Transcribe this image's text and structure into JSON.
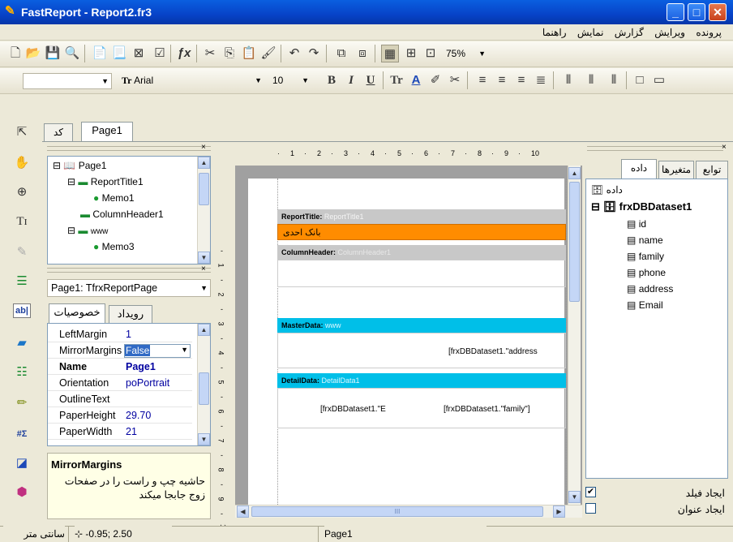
{
  "window": {
    "title": "FastReport - Report2.fr3",
    "minimize": "_",
    "maximize": "□",
    "close": "✕"
  },
  "menu": [
    "پرونده",
    "ویرایش",
    "گزارش",
    "نمایش",
    "راهنما"
  ],
  "toolbar1": {
    "zoom": "75%"
  },
  "toolbar2": {
    "font_name": "Arial",
    "font_size": "10",
    "bold": "B",
    "italic": "I",
    "underline": "U"
  },
  "design_tabs": {
    "code": "کد",
    "page": "Page1"
  },
  "report_tree": [
    {
      "label": "Page1",
      "level": 0,
      "type": "page"
    },
    {
      "label": "ReportTitle1",
      "level": 1,
      "type": "band"
    },
    {
      "label": "Memo1",
      "level": 2,
      "type": "memo"
    },
    {
      "label": "ColumnHeader1",
      "level": 1,
      "type": "band"
    },
    {
      "label": "www",
      "level": 1,
      "type": "band"
    },
    {
      "label": "Memo3",
      "level": 2,
      "type": "memo"
    }
  ],
  "object_selector": "Page1: TfrxReportPage",
  "inspector_tabs": {
    "properties": "خصوصیات",
    "events": "رویداد"
  },
  "properties": [
    {
      "name": "LeftMargin",
      "value": "1",
      "bold": false
    },
    {
      "name": "MirrorMargins",
      "value": "False",
      "bold": false,
      "selected": true
    },
    {
      "name": "Name",
      "value": "Page1",
      "bold": true
    },
    {
      "name": "Orientation",
      "value": "poPortrait",
      "bold": false
    },
    {
      "name": "OutlineText",
      "value": "",
      "bold": false
    },
    {
      "name": "PaperHeight",
      "value": "29.70",
      "bold": false
    },
    {
      "name": "PaperWidth",
      "value": "21",
      "bold": false
    }
  ],
  "help": {
    "title": "MirrorMargins",
    "text": "حاشیه چپ و راست را در صفحات زوج جابجا میکند"
  },
  "ruler": {
    "h_ticks": [
      "1",
      "2",
      "3",
      "4",
      "5",
      "6",
      "7",
      "8",
      "9",
      "10"
    ],
    "v_ticks": [
      "1",
      "2",
      "3",
      "4",
      "5",
      "6",
      "7",
      "8",
      "9",
      "10"
    ]
  },
  "bands": {
    "title": {
      "type": "ReportTitle:",
      "name": "ReportTitle1",
      "memo": "بانک احدی"
    },
    "header": {
      "type": "ColumnHeader:",
      "name": "ColumnHeader1"
    },
    "master": {
      "type": "MasterData:",
      "name": "www",
      "memo": "[frxDBDataset1.\"address"
    },
    "detail": {
      "type": "DetailData:",
      "name": "DetailData1",
      "memo1": "[frxDBDataset1.\"E",
      "memo2": "[frxDBDataset1.\"family\"]"
    }
  },
  "hscroll_mark": "III",
  "data_tabs": {
    "data": "داده",
    "variables": "متغیرها",
    "functions": "توابع"
  },
  "data_tree": {
    "root": "داده",
    "dataset": "frxDBDataset1",
    "fields": [
      "id",
      "name",
      "family",
      "phone",
      "address",
      "Email"
    ]
  },
  "data_options": {
    "create_field": "ایجاد فیلد",
    "create_title": "ایجاد عنوان"
  },
  "status": {
    "units": "سانتی متر",
    "coords": "-0.95; 2.50",
    "page": "Page1"
  },
  "colors": {
    "title_band": "#ff8c00",
    "data_band": "#00bfe8",
    "band_gray": "#c8c8c8"
  }
}
